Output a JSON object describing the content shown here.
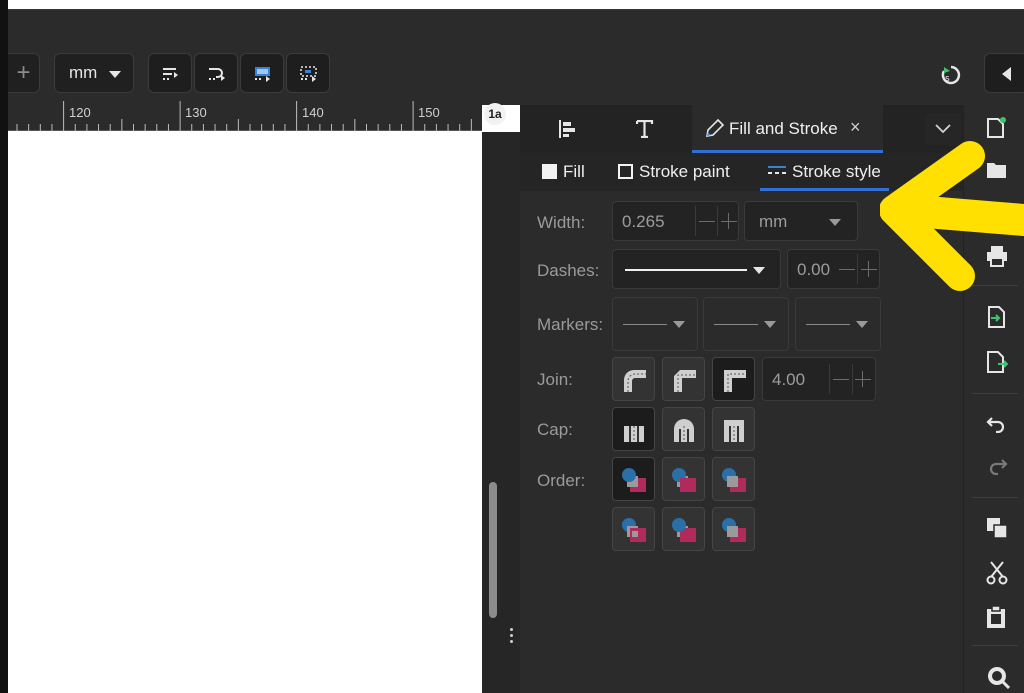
{
  "toolbar": {
    "unit": "mm",
    "snap_buttons": [
      "snap-bbox-icon",
      "snap-nodes-icon",
      "snap-page-icon",
      "snap-others-icon"
    ],
    "sync_icon": "sync-icon",
    "collapse_icon": "collapse-left-icon"
  },
  "ruler": {
    "labels": [
      "120",
      "130",
      "140",
      "150"
    ],
    "corner_glyph": "1a"
  },
  "dock": {
    "tabs": [
      {
        "icon": "align-icon"
      },
      {
        "icon": "text-icon"
      },
      {
        "icon": "fill-stroke-icon",
        "label": "Fill and Stroke",
        "close": "×"
      }
    ],
    "subtabs": {
      "fill": "Fill",
      "stroke_paint": "Stroke paint",
      "stroke_style": "Stroke style"
    },
    "form": {
      "width_label": "Width:",
      "width_value": "0.265",
      "width_unit": "mm",
      "dashes_label": "Dashes:",
      "dash_offset": "0.00",
      "markers_label": "Markers:",
      "join_label": "Join:",
      "miter_limit": "4.00",
      "cap_label": "Cap:",
      "order_label": "Order:"
    }
  },
  "cmdbar": {
    "icons": [
      "new-document-icon",
      "open-file-icon",
      "print-icon",
      "import-icon",
      "export-icon",
      "undo-icon",
      "redo-icon",
      "copy-icon",
      "cut-icon",
      "paste-icon",
      "zoom-icon"
    ]
  },
  "colors": {
    "accent": "#2f6fd6",
    "annotation": "#ffe000",
    "order_fill": "#b02a5c",
    "order_circle": "#2a6fa8"
  }
}
